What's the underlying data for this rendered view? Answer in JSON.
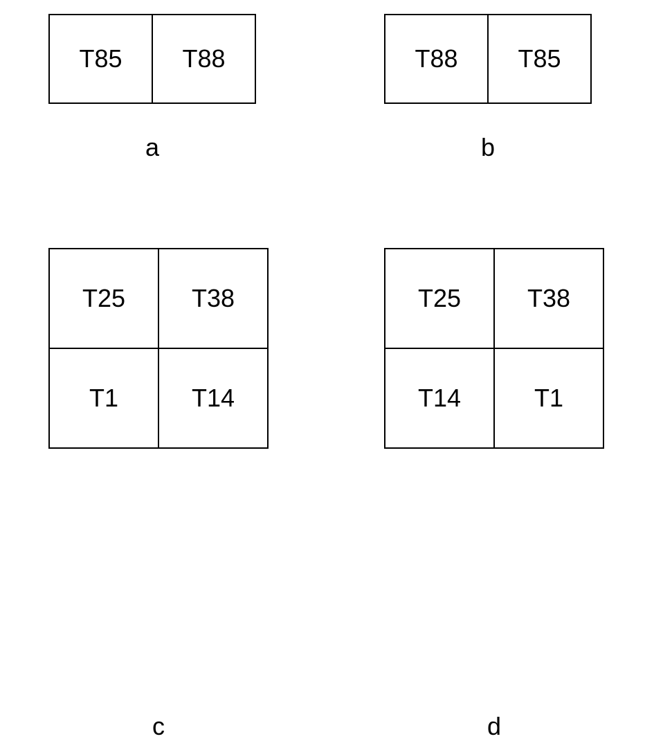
{
  "grid_a": {
    "label": "a",
    "cells": [
      "T85",
      "T88"
    ]
  },
  "grid_b": {
    "label": "b",
    "cells": [
      "T88",
      "T85"
    ]
  },
  "grid_c": {
    "label": "c",
    "cells": [
      "T25",
      "T38",
      "T1",
      "T14"
    ]
  },
  "grid_d": {
    "label": "d",
    "cells": [
      "T25",
      "T38",
      "T14",
      "T1"
    ]
  }
}
